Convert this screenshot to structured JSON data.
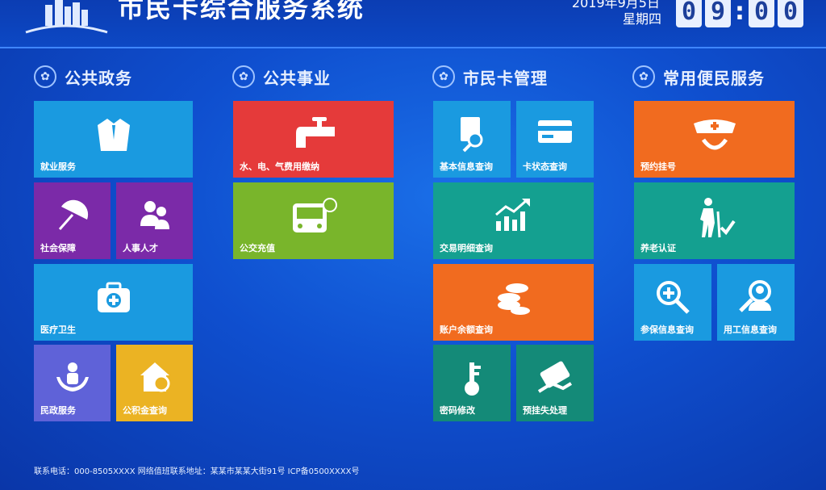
{
  "header": {
    "title": "市民卡综合服务系统",
    "date": "2019年9月5日",
    "weekday": "星期四",
    "clock_digits": [
      "0",
      "9",
      "0",
      "0"
    ],
    "clock_separator": ":"
  },
  "sections": [
    {
      "title": "公共政务",
      "icon": "emblem-icon"
    },
    {
      "title": "公共事业",
      "icon": "emblem-icon"
    },
    {
      "title": "市民卡管理",
      "icon": "emblem-icon"
    },
    {
      "title": "常用便民服务",
      "icon": "emblem-icon"
    }
  ],
  "tiles": {
    "employment": {
      "label": "就业服务",
      "icon": "shirt-icon",
      "color": "#1a9ae0"
    },
    "social_security": {
      "label": "社会保障",
      "icon": "umbrella-icon",
      "color": "#7b2aa8"
    },
    "hr_talent": {
      "label": "人事人才",
      "icon": "people-icon",
      "color": "#7b2aa8"
    },
    "medical": {
      "label": "医疗卫生",
      "icon": "medkit-icon",
      "color": "#1a9ae0"
    },
    "civil_affairs": {
      "label": "民政服务",
      "icon": "charity-icon",
      "color": "#5f62d8"
    },
    "housing_fund": {
      "label": "公积金查询",
      "icon": "house-coin-icon",
      "color": "#ebb323"
    },
    "utility_pay": {
      "label": "水、电、气费用缴纳",
      "icon": "faucet-icon",
      "color": "#e53a3a"
    },
    "bus_topup": {
      "label": "公交充值",
      "icon": "bus-icon",
      "color": "#79b52b"
    },
    "basic_info": {
      "label": "基本信息查询",
      "icon": "document-search-icon",
      "color": "#1a9ae0"
    },
    "card_status": {
      "label": "卡状态查询",
      "icon": "card-icon",
      "color": "#1a9ae0"
    },
    "transactions": {
      "label": "交易明细查询",
      "icon": "chart-up-icon",
      "color": "#14a090"
    },
    "balance": {
      "label": "账户余额查询",
      "icon": "coins-icon",
      "color": "#f16b1f"
    },
    "password": {
      "label": "密码修改",
      "icon": "key-icon",
      "color": "#148a78"
    },
    "report_loss": {
      "label": "预挂失处理",
      "icon": "card-hand-icon",
      "color": "#148a78"
    },
    "appointment": {
      "label": "预约挂号",
      "icon": "nurse-icon",
      "color": "#f16b1f"
    },
    "pension_cert": {
      "label": "养老认证",
      "icon": "elder-check-icon",
      "color": "#14a090"
    },
    "insurance_info": {
      "label": "参保信息查询",
      "icon": "magnifier-plus-icon",
      "color": "#1a9ae0"
    },
    "employment_info": {
      "label": "用工信息查询",
      "icon": "user-search-icon",
      "color": "#1a9ae0"
    }
  },
  "footer": {
    "text": "联系电话：000-8505XXXX   网络值班联系地址：某某市某某大街91号   ICP备0500XXXX号"
  }
}
